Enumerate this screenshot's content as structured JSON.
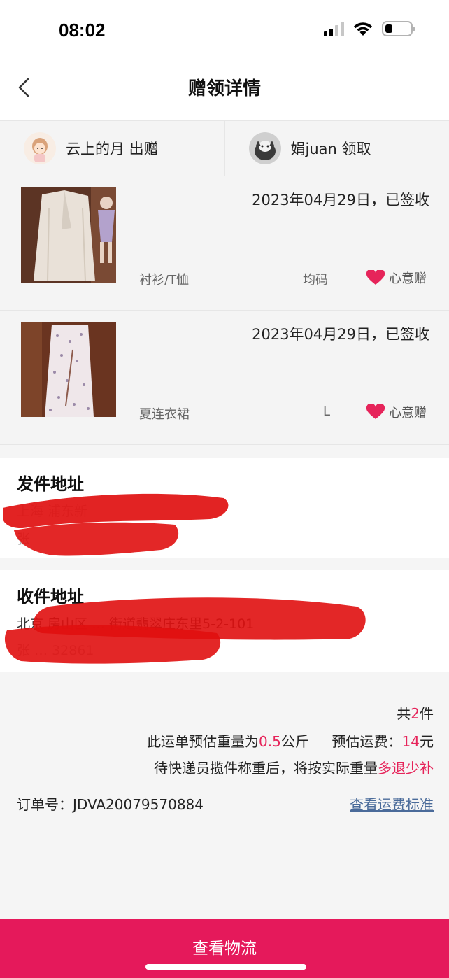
{
  "status_bar": {
    "time": "08:02"
  },
  "nav": {
    "title": "赠领详情"
  },
  "users": {
    "giver": "云上的月 出赠",
    "receiver": "娟juan 领取"
  },
  "items": [
    {
      "date": "2023年04月29日，已签收",
      "category": "衬衫/T恤",
      "size": "均码",
      "tag": "心意赠"
    },
    {
      "date": "2023年04月29日，已签收",
      "category": "夏连衣裙",
      "size": "L",
      "tag": "心意赠"
    }
  ],
  "sender_address": {
    "title": "发件地址",
    "line1": "上海 浦东新",
    "line2": "张"
  },
  "receiver_address": {
    "title": "收件地址",
    "line1": "北京 房山区 … 街道翡翠庄东里5-2-101",
    "line2": "张 … 32861"
  },
  "summary": {
    "count_prefix": "共",
    "count": "2",
    "count_suffix": "件",
    "weight_prefix": "此运单预估重量为",
    "weight": "0.5",
    "weight_unit": "公斤",
    "fee_label": "预估运费：",
    "fee": "14",
    "fee_unit": "元",
    "note": "待快递员揽件称重后，将按实际重量",
    "note_highlight": "多退少补",
    "order_no": "订单号：JDVA20079570884",
    "fee_link": "查看运费标准"
  },
  "bottom_button": "查看物流",
  "colors": {
    "accent": "#e5195b",
    "highlight": "#e6245a",
    "link": "#4a6b9a"
  }
}
